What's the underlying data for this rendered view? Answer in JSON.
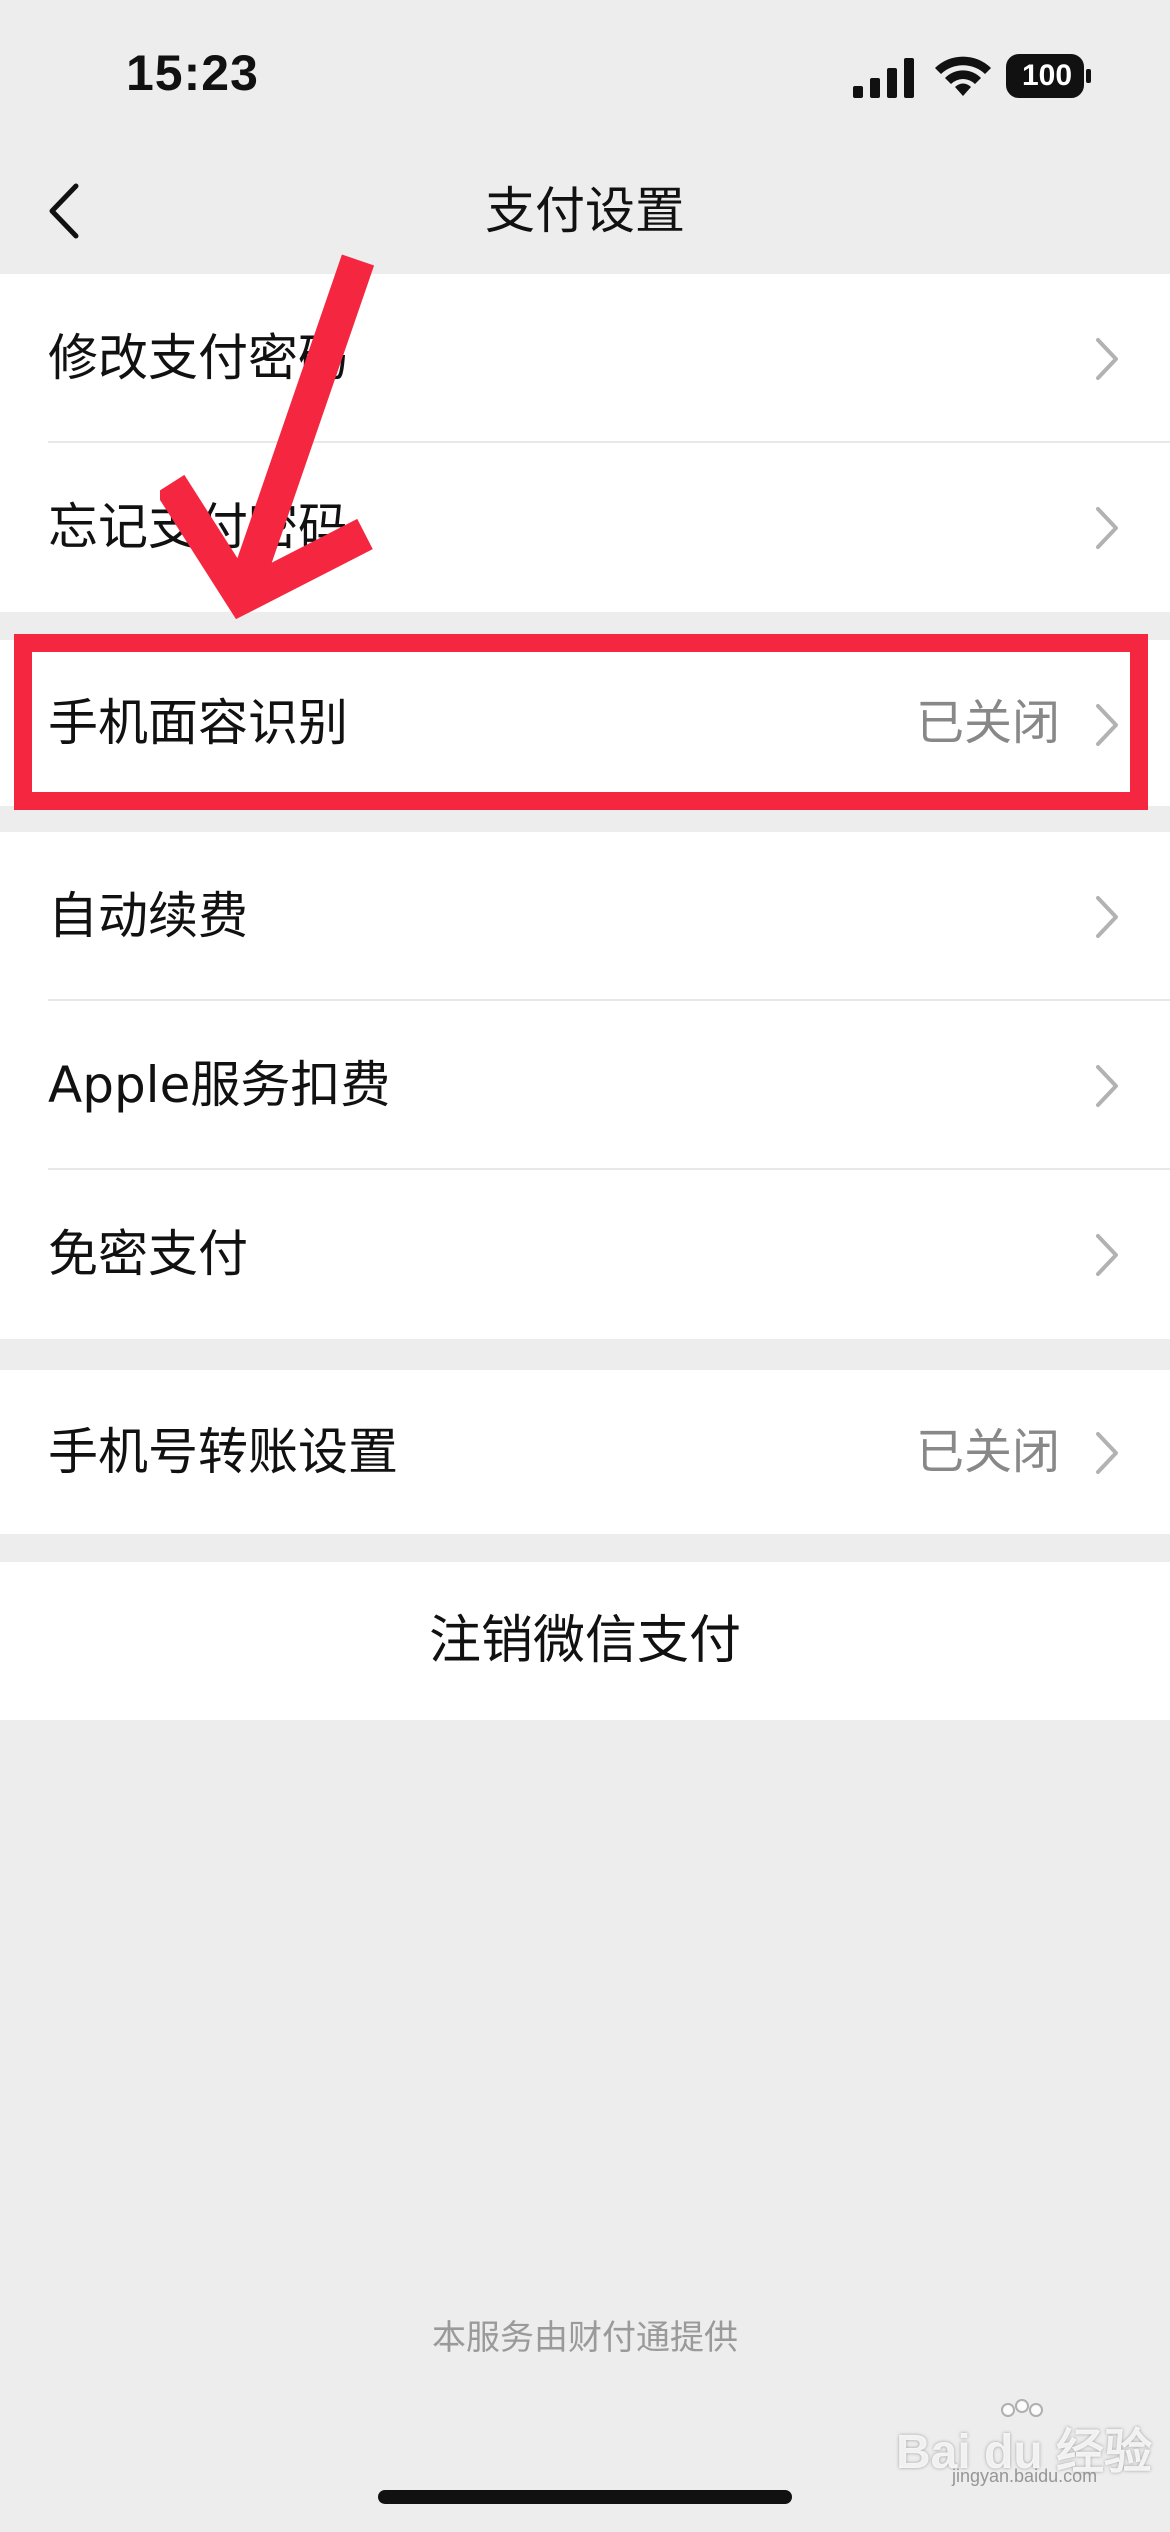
{
  "status_bar": {
    "time": "15:23",
    "battery_level": "100"
  },
  "nav": {
    "title": "支付设置",
    "back_icon": "chevron-left-icon"
  },
  "groups": [
    {
      "items": [
        {
          "label": "修改支付密码",
          "value": ""
        },
        {
          "label": "忘记支付密码",
          "value": ""
        }
      ]
    },
    {
      "items": [
        {
          "label": "手机面容识别",
          "value": "已关闭"
        }
      ]
    },
    {
      "items": [
        {
          "label": "自动续费",
          "value": ""
        },
        {
          "label": "Apple服务扣费",
          "value": ""
        },
        {
          "label": "免密支付",
          "value": ""
        }
      ]
    },
    {
      "items": [
        {
          "label": "手机号转账设置",
          "value": "已关闭"
        }
      ]
    }
  ],
  "cancel_action": {
    "label": "注销微信支付"
  },
  "footer": {
    "text": "本服务由财付通提供"
  },
  "watermark": {
    "text": "Bai du 经验",
    "sub": "jingyan.baidu.com"
  },
  "colors": {
    "background": "#ededed",
    "annotation_red": "#f5263f",
    "secondary_text": "#888888"
  }
}
